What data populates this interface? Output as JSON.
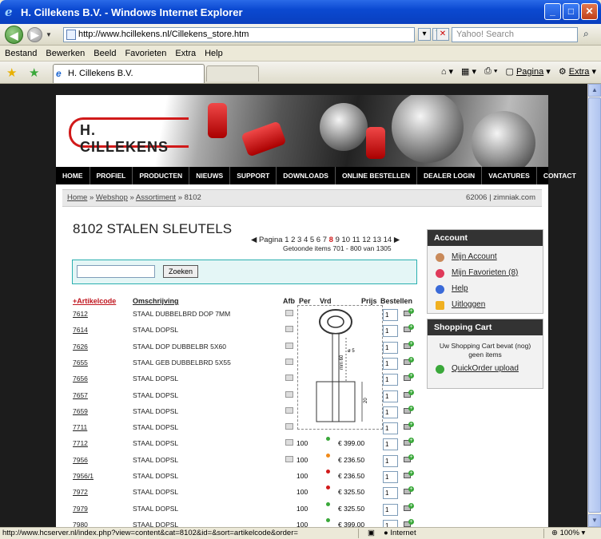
{
  "window": {
    "title": "H. Cillekens B.V. - Windows Internet Explorer"
  },
  "address": {
    "url": "http://www.hcillekens.nl/Cillekens_store.htm",
    "search_placeholder": "Yahoo! Search"
  },
  "menu": [
    "Bestand",
    "Bewerken",
    "Beeld",
    "Favorieten",
    "Extra",
    "Help"
  ],
  "tab": {
    "title": "H. Cillekens B.V."
  },
  "commands": {
    "pagina": "Pagina",
    "extra": "Extra"
  },
  "site": {
    "logo_text": "H. CILLEKENS",
    "nav": [
      "HOME",
      "PROFIEL",
      "PRODUCTEN",
      "NIEUWS",
      "SUPPORT",
      "DOWNLOADS",
      "ONLINE BESTELLEN",
      "DEALER LOGIN",
      "VACATURES",
      "CONTACT"
    ],
    "breadcrumb": {
      "home": "Home",
      "webshop": "Webshop",
      "assortiment": "Assortiment",
      "current": "8102",
      "right": "62006 | zimniak.com"
    },
    "title": "8102 STALEN SLEUTELS",
    "pager": {
      "label": "Pagina",
      "pages_before": "1 2 3 4 5 6 7",
      "current": "8",
      "pages_after": "9 10 11 12 13 14",
      "found": "Getoonde items 701 - 800 van 1305"
    },
    "search": {
      "button": "Zoeken"
    },
    "table": {
      "headers": {
        "code": "+Artikelcode",
        "desc": "Omschrijving",
        "afb": "Afb",
        "per": "Per",
        "vrd": "Vrd",
        "price": "Prijs",
        "order": "Bestellen"
      },
      "rows": [
        {
          "code": "7612",
          "desc": "STAAL DUBBELBRD DOP 7MM",
          "per": "",
          "price": "",
          "qty": "1",
          "dot": ""
        },
        {
          "code": "7614",
          "desc": "STAAL DOPSL",
          "per": "",
          "price": "",
          "qty": "1",
          "dot": ""
        },
        {
          "code": "7626",
          "desc": "STAAL DOP DUBBELBR 5X60",
          "per": "",
          "price": "",
          "qty": "1",
          "dot": ""
        },
        {
          "code": "7655",
          "desc": "STAAL GEB DUBBELBRD 5X55",
          "per": "",
          "price": "",
          "qty": "1",
          "dot": ""
        },
        {
          "code": "7656",
          "desc": "STAAL DOPSL",
          "per": "",
          "price": "",
          "qty": "1",
          "dot": ""
        },
        {
          "code": "7657",
          "desc": "STAAL DOPSL",
          "per": "",
          "price": "",
          "qty": "1",
          "dot": ""
        },
        {
          "code": "7659",
          "desc": "STAAL DOPSL",
          "per": "",
          "price": "",
          "qty": "1",
          "dot": ""
        },
        {
          "code": "7711",
          "desc": "STAAL DOPSL",
          "per": "",
          "price": "",
          "qty": "1",
          "dot": ""
        },
        {
          "code": "7712",
          "desc": "STAAL DOPSL",
          "per": "100",
          "price": "€ 399.00",
          "qty": "1",
          "dot": "#3aa83a"
        },
        {
          "code": "7956",
          "desc": "STAAL DOPSL",
          "per": "100",
          "price": "€ 236.50",
          "qty": "1",
          "dot": "#f08a1a"
        },
        {
          "code": "7956/1",
          "desc": "STAAL DOPSL",
          "per": "100",
          "price": "€ 236.50",
          "qty": "1",
          "dot": "#d11a1a"
        },
        {
          "code": "7972",
          "desc": "STAAL DOPSL",
          "per": "100",
          "price": "€ 325.50",
          "qty": "1",
          "dot": "#d11a1a"
        },
        {
          "code": "7979",
          "desc": "STAAL DOPSL",
          "per": "100",
          "price": "€ 325.50",
          "qty": "1",
          "dot": "#3aa83a"
        },
        {
          "code": "7980",
          "desc": "STAAL DOPSL",
          "per": "100",
          "price": "€ 399.00",
          "qty": "1",
          "dot": "#3aa83a"
        }
      ]
    },
    "account": {
      "title": "Account",
      "items": [
        "Mijn Account",
        "Mijn Favorieten (8)",
        "Help",
        "Uitloggen"
      ]
    },
    "cart": {
      "title": "Shopping Cart",
      "empty_text": "Uw Shopping Cart bevat (nog) geen items",
      "quickorder": "QuickOrder upload"
    }
  },
  "status": {
    "url": "http://www.hcserver.nl/index.php?view=content&cat=8102&id=&sort=artikelcode&order=",
    "zone": "Internet",
    "zoom": "100%"
  },
  "colors": {
    "accent_red": "#d11a1a",
    "panel_cyan": "#e4f6f6"
  }
}
